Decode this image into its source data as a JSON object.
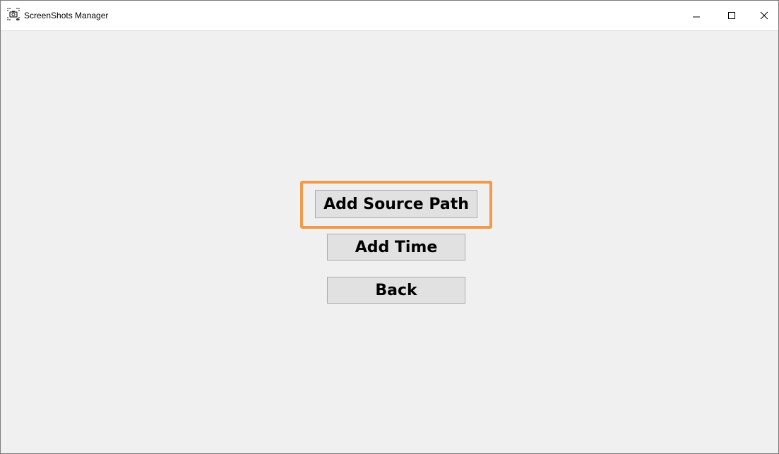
{
  "window": {
    "title": "ScreenShots Manager",
    "app_icon": "camera-screenshot-icon",
    "controls": [
      "minimize-icon",
      "maximize-icon",
      "close-icon"
    ]
  },
  "main": {
    "buttons": [
      {
        "label": "Add Source Path",
        "highlighted": true
      },
      {
        "label": "Add Time",
        "highlighted": false
      },
      {
        "label": "Back",
        "highlighted": false
      }
    ]
  },
  "colors": {
    "background": "#f0f0f0",
    "titlebar": "#ffffff",
    "button_face": "#e1e1e1",
    "button_border": "#adadad",
    "highlight": "#f29a4a"
  }
}
